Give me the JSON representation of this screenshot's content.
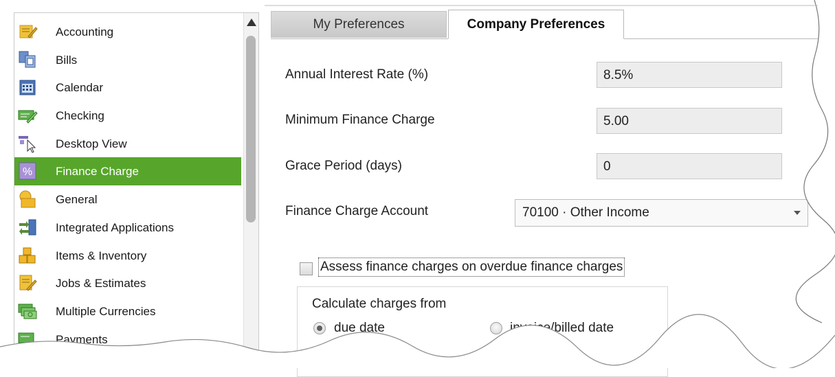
{
  "sidebar": {
    "items": [
      {
        "label": "Accounting",
        "icon": "accounting-icon"
      },
      {
        "label": "Bills",
        "icon": "bills-icon"
      },
      {
        "label": "Calendar",
        "icon": "calendar-icon"
      },
      {
        "label": "Checking",
        "icon": "checking-icon"
      },
      {
        "label": "Desktop View",
        "icon": "desktop-view-icon"
      },
      {
        "label": "Finance Charge",
        "icon": "percent-icon",
        "selected": true
      },
      {
        "label": "General",
        "icon": "general-icon"
      },
      {
        "label": "Integrated Applications",
        "icon": "integrated-apps-icon"
      },
      {
        "label": "Items & Inventory",
        "icon": "items-inventory-icon"
      },
      {
        "label": "Jobs & Estimates",
        "icon": "jobs-estimates-icon"
      },
      {
        "label": "Multiple Currencies",
        "icon": "currencies-icon"
      },
      {
        "label": "Payments",
        "icon": "payments-icon"
      }
    ],
    "selected_color": "#57a62b"
  },
  "tabs": {
    "my_preferences": "My Preferences",
    "company_preferences": "Company Preferences",
    "active": "Company Preferences"
  },
  "form": {
    "annual_interest_rate": {
      "label": "Annual Interest Rate (%)",
      "value": "8.5%"
    },
    "minimum_finance_charge": {
      "label": "Minimum Finance Charge",
      "value": "5.00"
    },
    "grace_period": {
      "label": "Grace Period (days)",
      "value": "0"
    },
    "finance_charge_account": {
      "label": "Finance Charge Account",
      "value": "70100 · Other Income"
    },
    "assess_overdue": {
      "label": "Assess finance charges on overdue finance charges",
      "checked": false
    },
    "calculate_from": {
      "title": "Calculate charges from",
      "options": [
        {
          "label": "due date",
          "selected": true
        },
        {
          "label": "invoice/billed date",
          "selected": false
        }
      ]
    }
  }
}
